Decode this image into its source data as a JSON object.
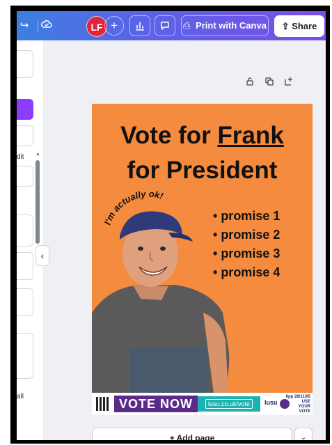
{
  "topbar": {
    "avatar_initials": "LF",
    "print_label": "Print with Canva",
    "share_label": "Share",
    "gradient_start": "#3e7fe0",
    "gradient_end": "#7a4fe8"
  },
  "leftpanel": {
    "label_edit": "dit",
    "label_all": "all",
    "accent": "#8b3dff"
  },
  "poster": {
    "background": "#f58b3e",
    "title_line1_prefix": "Vote for ",
    "title_line1_name": "Frank",
    "title_line2": "for President",
    "arc_text": "I'm actually ok!",
    "promises": [
      "promise 1",
      "promise 2",
      "promise 3",
      "promise 4"
    ],
    "vote_now": "VOTE NOW",
    "url": "lusu.co.uk/vote",
    "lusu": "lusu",
    "date": "6pp 28/11/05",
    "use_your_vote_1": "USE",
    "use_your_vote_2": "YOUR",
    "use_your_vote_3": "VOTE"
  },
  "canvas": {
    "add_page_label": "+ Add page"
  },
  "icons": [
    "undo-icon",
    "cloud-check-icon",
    "insights-icon",
    "comment-icon",
    "print-icon",
    "share-icon",
    "lock-icon",
    "duplicate-icon",
    "add-page-icon",
    "chevron-left-icon",
    "chevron-down-icon"
  ]
}
